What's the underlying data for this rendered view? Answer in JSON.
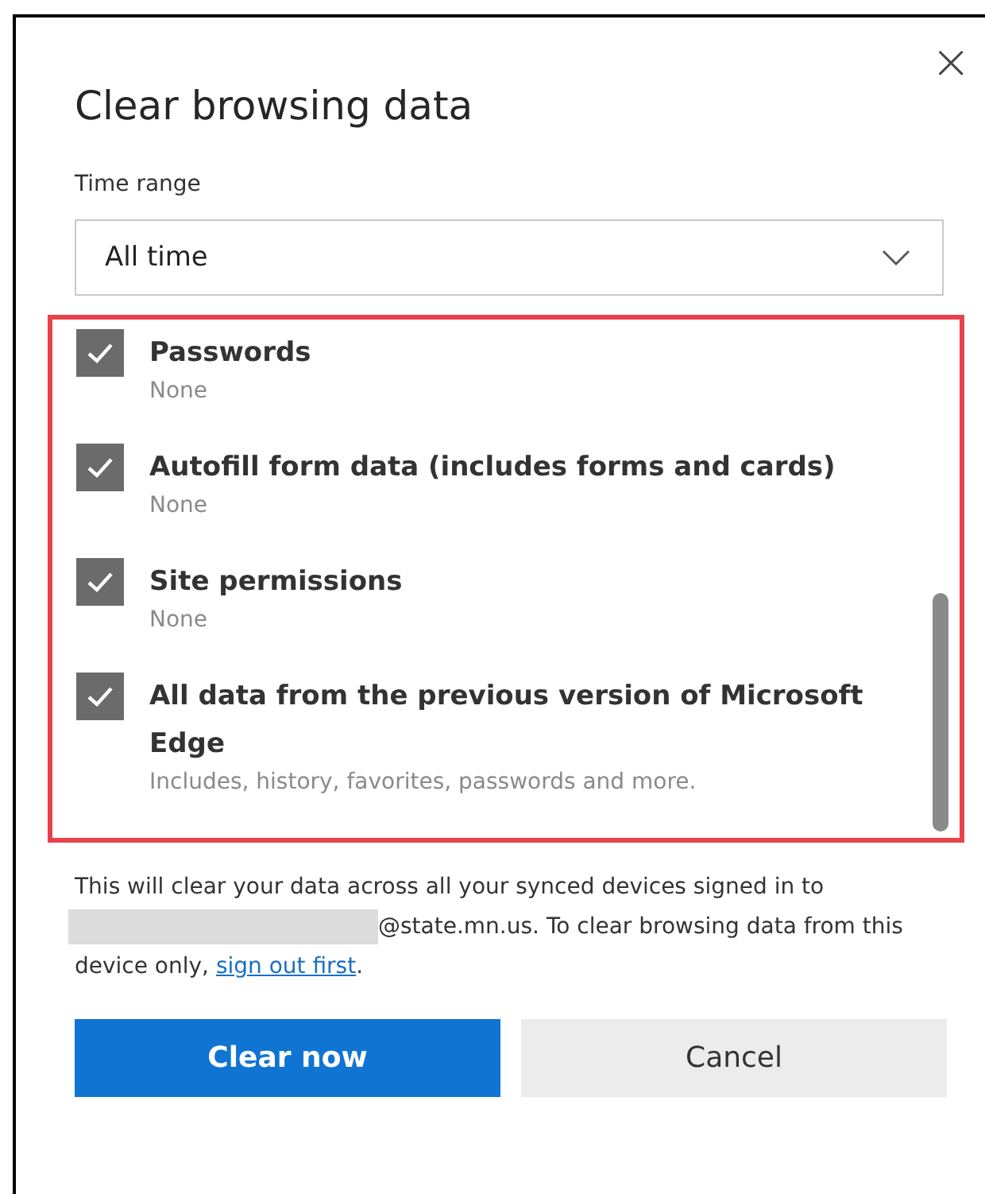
{
  "dialog": {
    "title": "Clear browsing data",
    "close_icon": "×"
  },
  "time_range": {
    "label": "Time range",
    "value": "All time"
  },
  "items": [
    {
      "label": "Passwords",
      "detail": "None",
      "checked": true
    },
    {
      "label": "Autofill form data (includes forms and cards)",
      "detail": "None",
      "checked": true
    },
    {
      "label": "Site permissions",
      "detail": "None",
      "checked": true
    },
    {
      "label": "All data from the previous version of Microsoft Edge",
      "detail": "Includes, history, favorites, passwords and more.",
      "checked": true
    }
  ],
  "notice": {
    "before": "This will clear your data across all your synced devices signed in to",
    "email_redacted": true,
    "after": "@state.mn.us. To clear browsing data from this device only,",
    "link": "sign out first",
    "end": "."
  },
  "buttons": [
    {
      "label": "Clear now",
      "kind": "primary"
    },
    {
      "label": "Cancel",
      "kind": "secondary"
    }
  ]
}
